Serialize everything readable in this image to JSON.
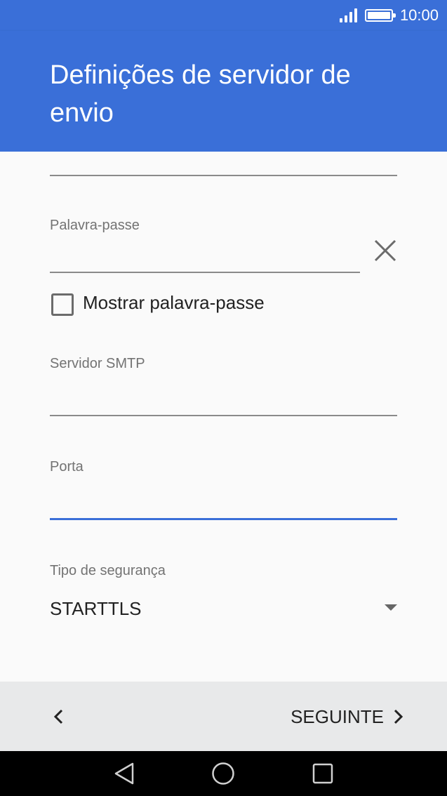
{
  "status_bar": {
    "time": "10:00",
    "signal_icon": "signal-icon",
    "battery_icon": "battery-icon"
  },
  "app_bar": {
    "title": "Definições de servidor de envio"
  },
  "form": {
    "password": {
      "label": "Palavra-passe",
      "value": "",
      "clear_icon": "close-icon"
    },
    "show_password": {
      "label": "Mostrar palavra-passe",
      "checked": false
    },
    "smtp_server": {
      "label": "Servidor SMTP",
      "value": ""
    },
    "port": {
      "label": "Porta",
      "value": ""
    },
    "security_type": {
      "label": "Tipo de segurança",
      "value": "STARTTLS"
    }
  },
  "bottom_bar": {
    "next_label": "SEGUINTE",
    "back_icon": "chevron-left-icon",
    "next_icon": "chevron-right-icon"
  },
  "nav_bar": {
    "back_icon": "nav-back-icon",
    "home_icon": "nav-home-icon",
    "recents_icon": "nav-recents-icon"
  },
  "colors": {
    "primary": "#3a6fd8",
    "background": "#fafafa",
    "bottom_bar": "#e8e9ea"
  }
}
